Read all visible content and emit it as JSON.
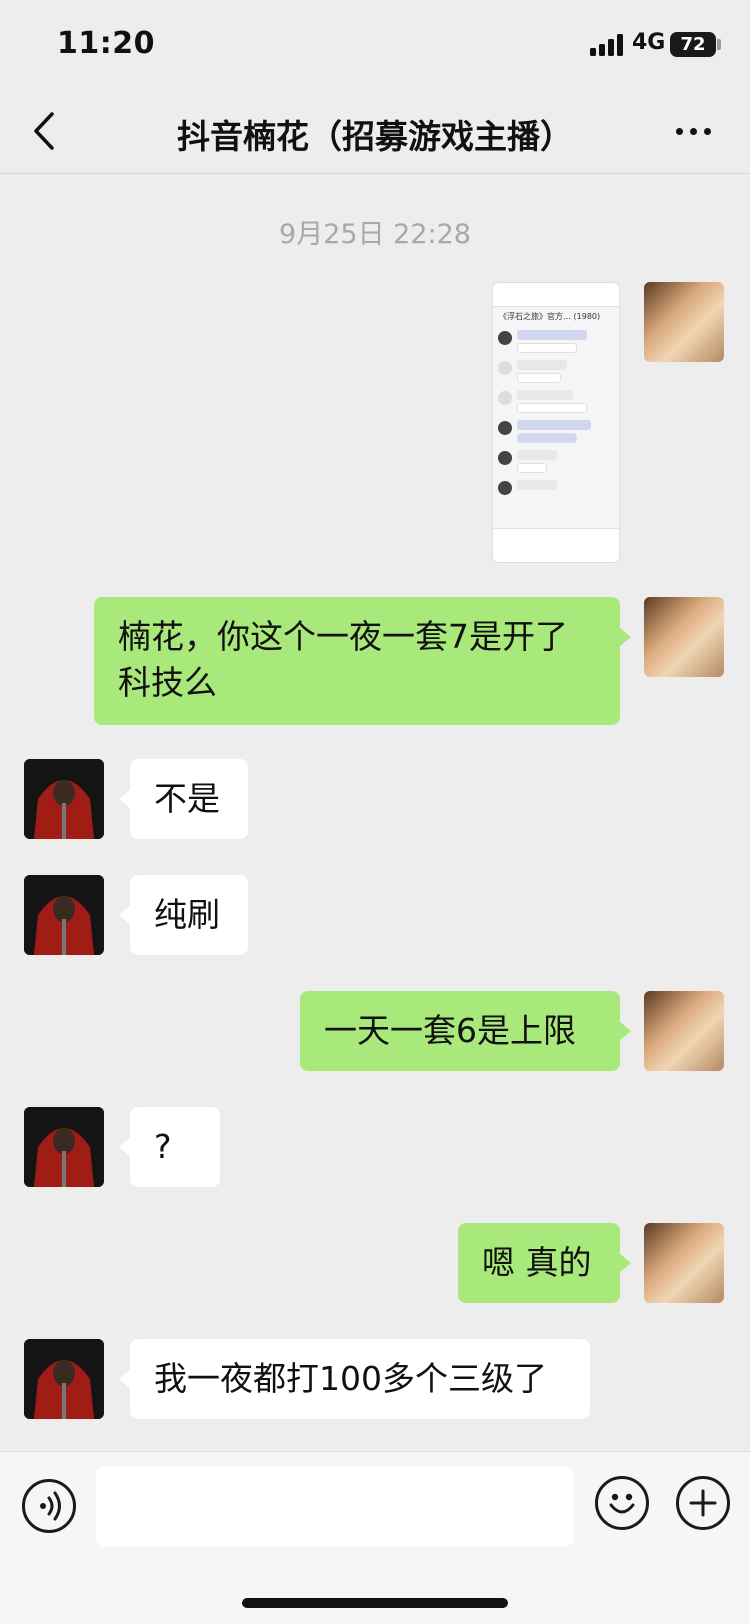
{
  "status_bar": {
    "time": "11:20",
    "network": "4G",
    "battery": "72"
  },
  "header": {
    "title": "抖音楠花（招募游戏主播）"
  },
  "timestamp": "9月25日 22:28",
  "image_preview": {
    "title": "《浮石之旅》官方… (1980)"
  },
  "messages": [
    {
      "from": "me",
      "text": "楠花，你这个一夜一套7是开了科技么"
    },
    {
      "from": "them",
      "text": "不是"
    },
    {
      "from": "them",
      "text": "纯刷"
    },
    {
      "from": "me",
      "text": "一天一套6是上限"
    },
    {
      "from": "them",
      "text": "?"
    },
    {
      "from": "me",
      "text": "嗯 真的"
    },
    {
      "from": "them",
      "text": "我一夜都打100多个三级了"
    }
  ],
  "input": {
    "value": ""
  },
  "icons": {
    "back": "chevron-left",
    "more": "more-horizontal",
    "voice": "voice-wave",
    "emoji": "smiley",
    "plus": "plus-circle"
  }
}
